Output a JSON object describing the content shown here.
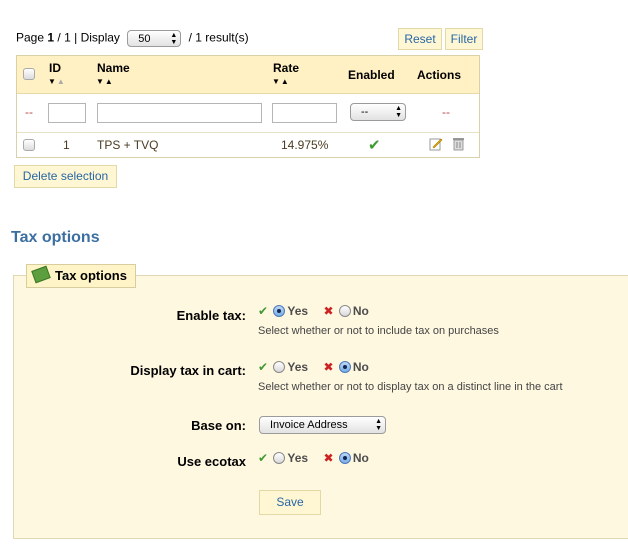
{
  "pager": {
    "page_label": "Page",
    "current": "1",
    "separator": "/",
    "total": "1",
    "display_label": "| Display",
    "per_page": "50",
    "results": "/ 1 result(s)"
  },
  "buttons": {
    "reset": "Reset",
    "filter": "Filter",
    "delete_selection": "Delete selection",
    "save": "Save"
  },
  "table": {
    "columns": [
      "ID",
      "Name",
      "Rate",
      "Enabled",
      "Actions"
    ],
    "filter_placeholder_dash": "--",
    "enabled_filter_value": "--",
    "rows": [
      {
        "id": "1",
        "name": "TPS + TVQ",
        "rate": "14.975%",
        "enabled": true
      }
    ]
  },
  "section_title": "Tax options",
  "form": {
    "legend": "Tax options",
    "fields": [
      {
        "label": "Enable tax:",
        "yes": "Yes",
        "no": "No",
        "selected": "yes",
        "hint": "Select whether or not to include tax on purchases"
      },
      {
        "label": "Display tax in cart:",
        "yes": "Yes",
        "no": "No",
        "selected": "no",
        "hint": "Select whether or not to display tax on a distinct line in the cart"
      },
      {
        "label": "Base on:",
        "value": "Invoice Address"
      },
      {
        "label": "Use ecotax",
        "yes": "Yes",
        "no": "No",
        "selected": "no"
      }
    ]
  },
  "colors": {
    "accent_blue": "#2767a6",
    "header_bg": "#fff1c4",
    "fieldset_bg": "#fff8e1",
    "check_green": "#3f9a33",
    "cross_red": "#cc2222"
  },
  "icons": {
    "enabled": "check-icon",
    "edit": "edit-icon",
    "delete": "trash-icon",
    "legend": "money-icon"
  }
}
